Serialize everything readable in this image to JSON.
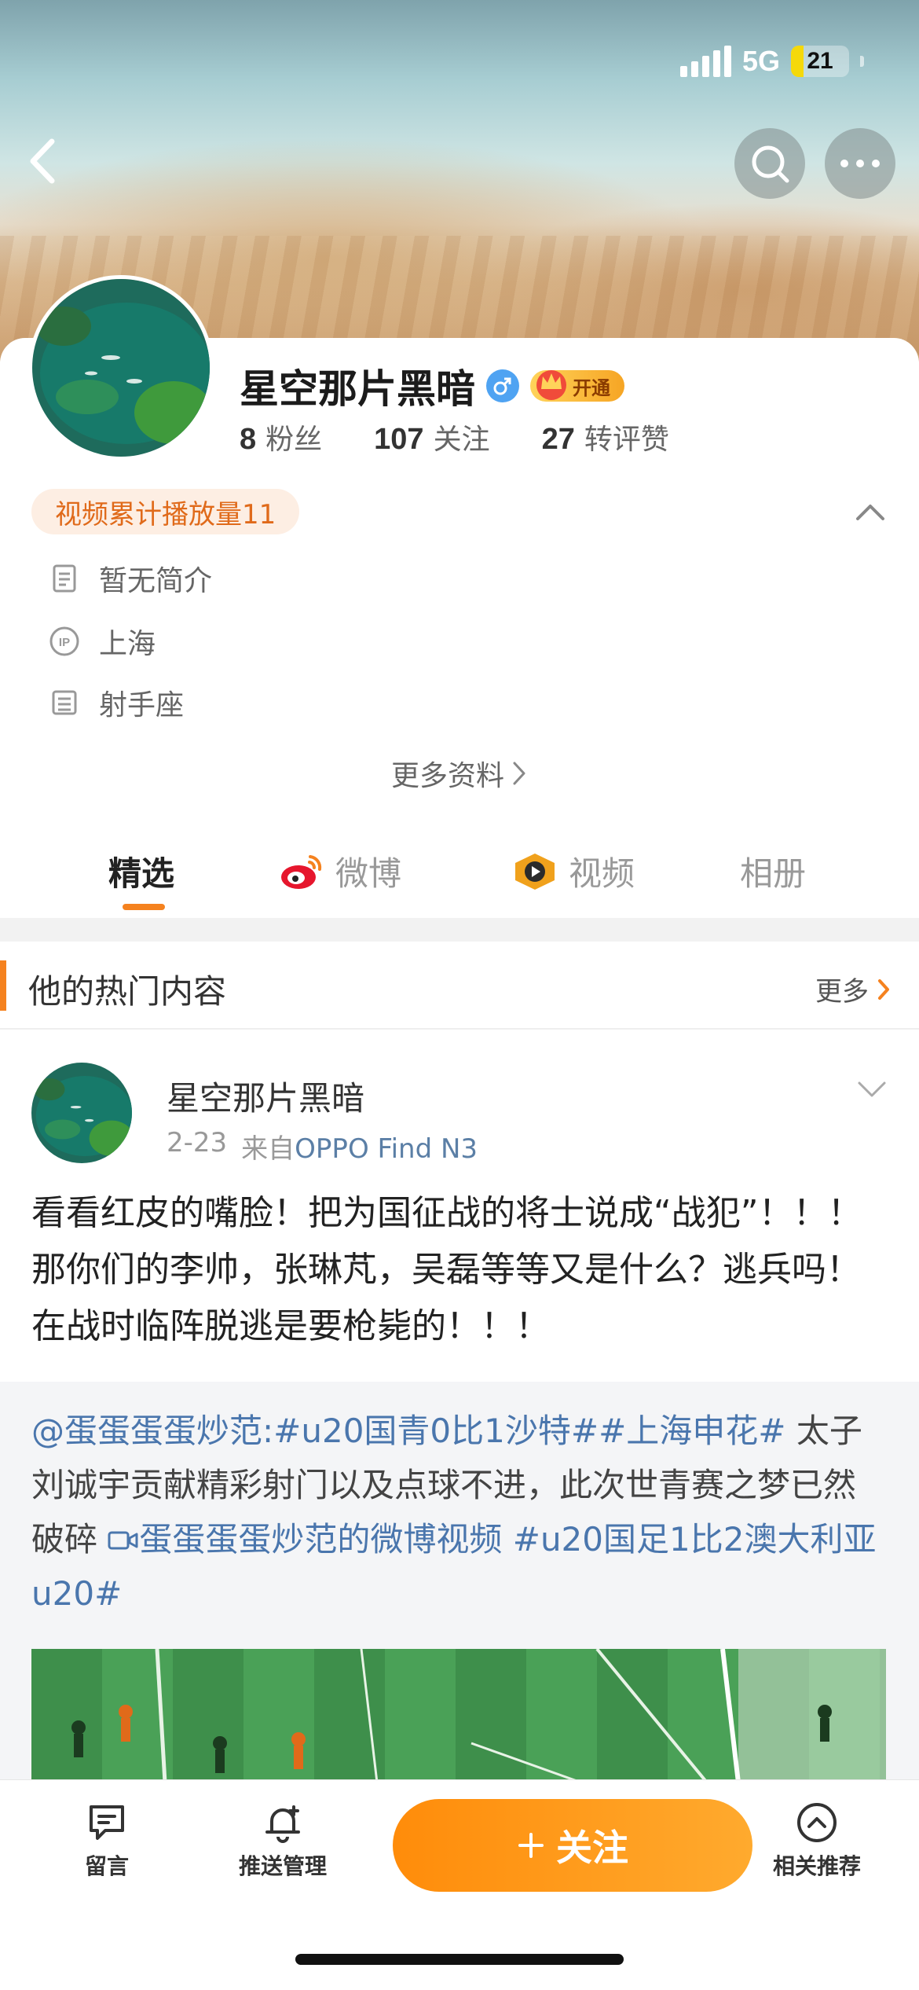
{
  "status_bar": {
    "network": "5G",
    "battery_level": "21",
    "battery_fraction": 0.21
  },
  "header": {
    "back_icon": "chevron-left-icon",
    "search_icon": "search-icon",
    "more_icon": "more-horizontal-icon"
  },
  "profile": {
    "username": "星空那片黑暗",
    "gender_icon": "male-icon",
    "vip_label": "开通",
    "stats": [
      {
        "value": "8",
        "label": "粉丝"
      },
      {
        "value": "107",
        "label": "关注"
      },
      {
        "value": "27",
        "label": "转评赞"
      }
    ],
    "video_pill": "视频累计播放量11",
    "info": [
      {
        "icon": "document-icon",
        "text": "暂无简介"
      },
      {
        "icon": "ip-icon",
        "text": "上海"
      },
      {
        "icon": "calendar-icon",
        "text": "射手座"
      }
    ],
    "more_info": "更多资料"
  },
  "tabs": [
    {
      "label": "精选",
      "active": true
    },
    {
      "label": "微博",
      "active": false,
      "icon": "weibo-icon"
    },
    {
      "label": "视频",
      "active": false,
      "icon": "video-channel-icon"
    },
    {
      "label": "相册",
      "active": false
    }
  ],
  "hot_section": {
    "title": "他的热门内容",
    "more": "更多"
  },
  "post": {
    "author": "星空那片黑暗",
    "date": "2-23",
    "source_prefix": "来自",
    "device": "OPPO Find N3",
    "text": "看看红皮的嘴脸！把为国征战的将士说成“战犯”！！！那你们的李帅，张琳芃，吴磊等等又是什么？逃兵吗！在战时临阵脱逃是要枪毙的！！！",
    "repost": {
      "mention": "@蛋蛋蛋蛋炒范",
      "colon": ":",
      "hashtag1": "#u20国青0比1沙特#",
      "hashtag2": "#上海申花#",
      "body": "太子刘诚宇贡献精彩射门以及点球不进，此次世青赛之梦已然破碎",
      "video_link": "蛋蛋蛋蛋炒范的微博视频",
      "hashtag3": "#u20国足1比2澳大利亚u20#"
    }
  },
  "bottom_bar": {
    "message": "留言",
    "push": "推送管理",
    "follow": "关注",
    "related": "相关推荐"
  },
  "colors": {
    "accent": "#f5821f",
    "link": "#4a76ad",
    "gender": "#4fa3f2"
  }
}
